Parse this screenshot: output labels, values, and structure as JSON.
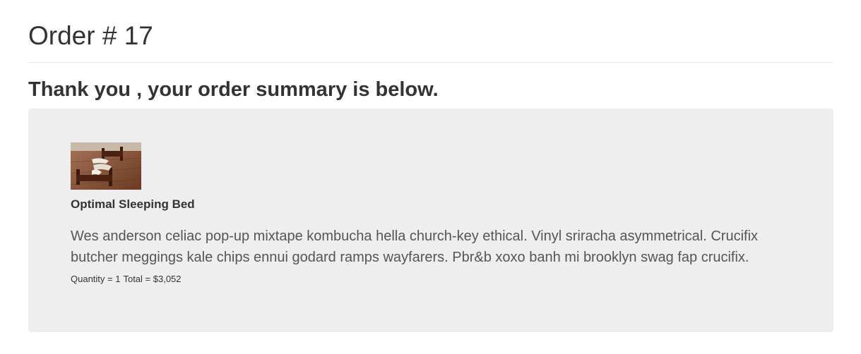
{
  "order": {
    "title": "Order # 17",
    "thanks_message": "Thank you , your order summary is below."
  },
  "item": {
    "image_alt": "bed-photo",
    "name": "Optimal Sleeping Bed",
    "description": "Wes anderson celiac pop-up mixtape kombucha hella church-key ethical. Vinyl sriracha asymmetrical. Crucifix butcher meggings kale chips ennui godard ramps wayfarers. Pbr&b xoxo banh mi brooklyn swag fap crucifix.",
    "quantity_text": "Quantity = 1",
    "total_text": "Total = $3,052"
  },
  "colors": {
    "well_background": "#eeeeee",
    "text": "#333333",
    "muted_text": "#555555"
  }
}
